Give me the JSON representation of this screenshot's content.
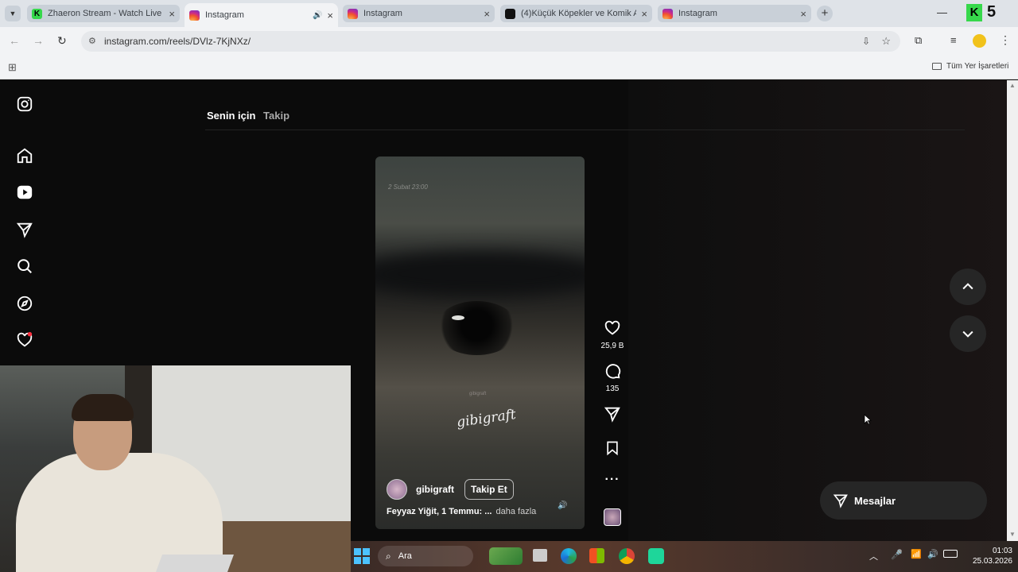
{
  "browser": {
    "tabs": [
      {
        "title": "Zhaeron Stream - Watch Live o",
        "favicon": "kick-icon",
        "active": false
      },
      {
        "title": "Instagram",
        "favicon": "instagram-icon",
        "active": true,
        "audio": true
      },
      {
        "title": "Instagram",
        "favicon": "instagram-icon",
        "active": false
      },
      {
        "title": "(4)Küçük Köpekler ve Komik An",
        "favicon": "tiktok-icon",
        "active": false
      },
      {
        "title": "Instagram",
        "favicon": "instagram-icon",
        "active": false
      }
    ],
    "url": "instagram.com/reels/DVlz-7KjNXz/",
    "bookmarks_label": "Tüm Yer İşaretleri",
    "kick_badge": "5"
  },
  "instagram": {
    "feed_tabs": {
      "for_you": "Senin için",
      "following": "Takip"
    },
    "video": {
      "overlay_date": "2 Subat 23:00",
      "watermark": "gibigraft",
      "small_tag": "gibigraft"
    },
    "author": {
      "username": "gibigraft",
      "follow_label": "Takip Et"
    },
    "caption": {
      "text": "Feyyaz Yiğit, 1 Temmu: ...",
      "more": "daha fazla"
    },
    "actions": {
      "likes": "25,9 B",
      "comments": "135"
    },
    "messages_label": "Mesajlar"
  },
  "taskbar": {
    "search_placeholder": "Ara",
    "time": "01:03",
    "date": "25.03.2026"
  },
  "colors": {
    "accent": "#ffffff",
    "notification": "#ff3040",
    "kick": "#36d84b"
  }
}
